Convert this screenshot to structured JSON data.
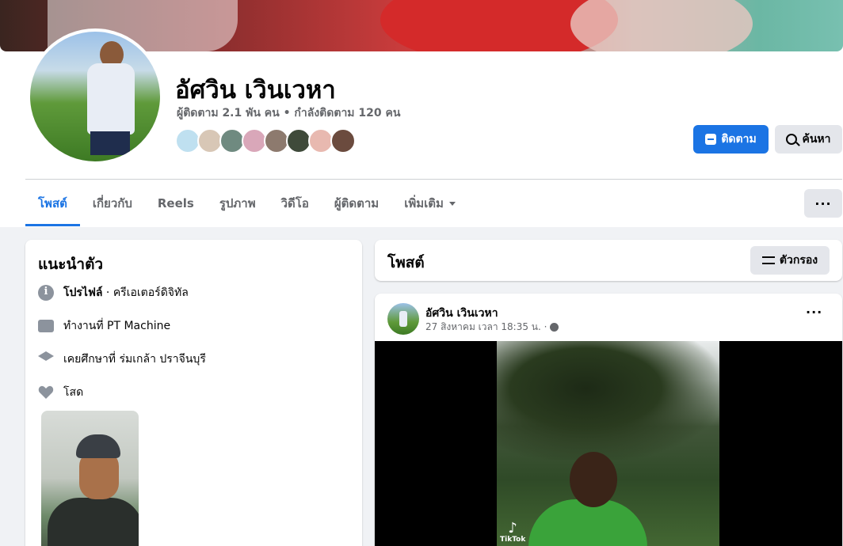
{
  "profile": {
    "name": "อัศวิน เวินเวหา",
    "stats": "ผู้ติดตาม 2.1 พัน คน • กำลังติดตาม 120 คน",
    "follower_avatar_colors": [
      "#bfe0f0",
      "#d8c7b6",
      "#6f8a80",
      "#d9a7b9",
      "#8d7a6e",
      "#3f4a3a",
      "#e8b9b0",
      "#6b4b3e"
    ]
  },
  "actions": {
    "follow_label": "ติดตาม",
    "search_label": "ค้นหา"
  },
  "tabs": [
    {
      "label": "โพสต์"
    },
    {
      "label": "เกี่ยวกับ"
    },
    {
      "label": "Reels"
    },
    {
      "label": "รูปภาพ"
    },
    {
      "label": "วิดีโอ"
    },
    {
      "label": "ผู้ติดตาม"
    },
    {
      "label": "เพิ่มเติม"
    }
  ],
  "more_button_label": "···",
  "intro": {
    "title": "แนะนำตัว",
    "profile_label": "โปรไฟล์",
    "profile_value": " · ครีเอเตอร์ดิจิทัล",
    "work": "ทำงานที่ PT Machine",
    "education": "เคยศึกษาที่ ร่มเกล้า ปราจีนบุรี",
    "relationship": "โสด"
  },
  "posts": {
    "title": "โพสต์",
    "filter_label": "ตัวกรอง"
  },
  "post": {
    "author": "อัศวิน เวินเวหา",
    "timestamp": "27 สิงหาคม เวลา 18:35 น. ·",
    "more_label": "···",
    "watermark": "TikTok"
  },
  "colors": {
    "accent": "#1b74e4",
    "page_bg": "#f0f2f5",
    "secondary_text": "#65676b",
    "button_gray": "#e4e6eb"
  }
}
